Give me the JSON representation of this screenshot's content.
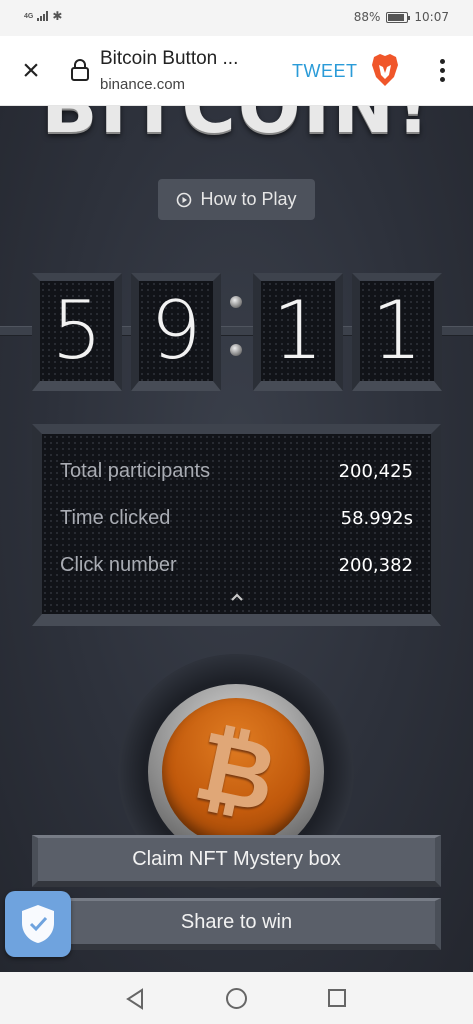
{
  "status_bar": {
    "network_label": "4G",
    "battery_percent": "88%",
    "time": "10:07"
  },
  "browser": {
    "page_title": "Bitcoin Button ...",
    "url": "binance.com",
    "tweet_label": "TWEET",
    "icons": [
      "close-icon",
      "lock-icon",
      "brave-lion-icon",
      "more-vert-icon"
    ]
  },
  "game": {
    "title": "BITCOIN!",
    "how_to_play_label": "How to Play",
    "timer_digits": [
      "5",
      "9",
      "1",
      "1"
    ],
    "stats": [
      {
        "label": "Total participants",
        "value": "200,425"
      },
      {
        "label": "Time clicked",
        "value": "58.992s"
      },
      {
        "label": "Click number",
        "value": "200,382"
      }
    ],
    "bitcoin_symbol": "₿",
    "claim_label": "Claim NFT Mystery box",
    "share_label": "Share to win",
    "accent_color": "#c25a0c"
  },
  "nav": {
    "icons": [
      "back-icon",
      "home-icon",
      "recent-apps-icon"
    ]
  }
}
